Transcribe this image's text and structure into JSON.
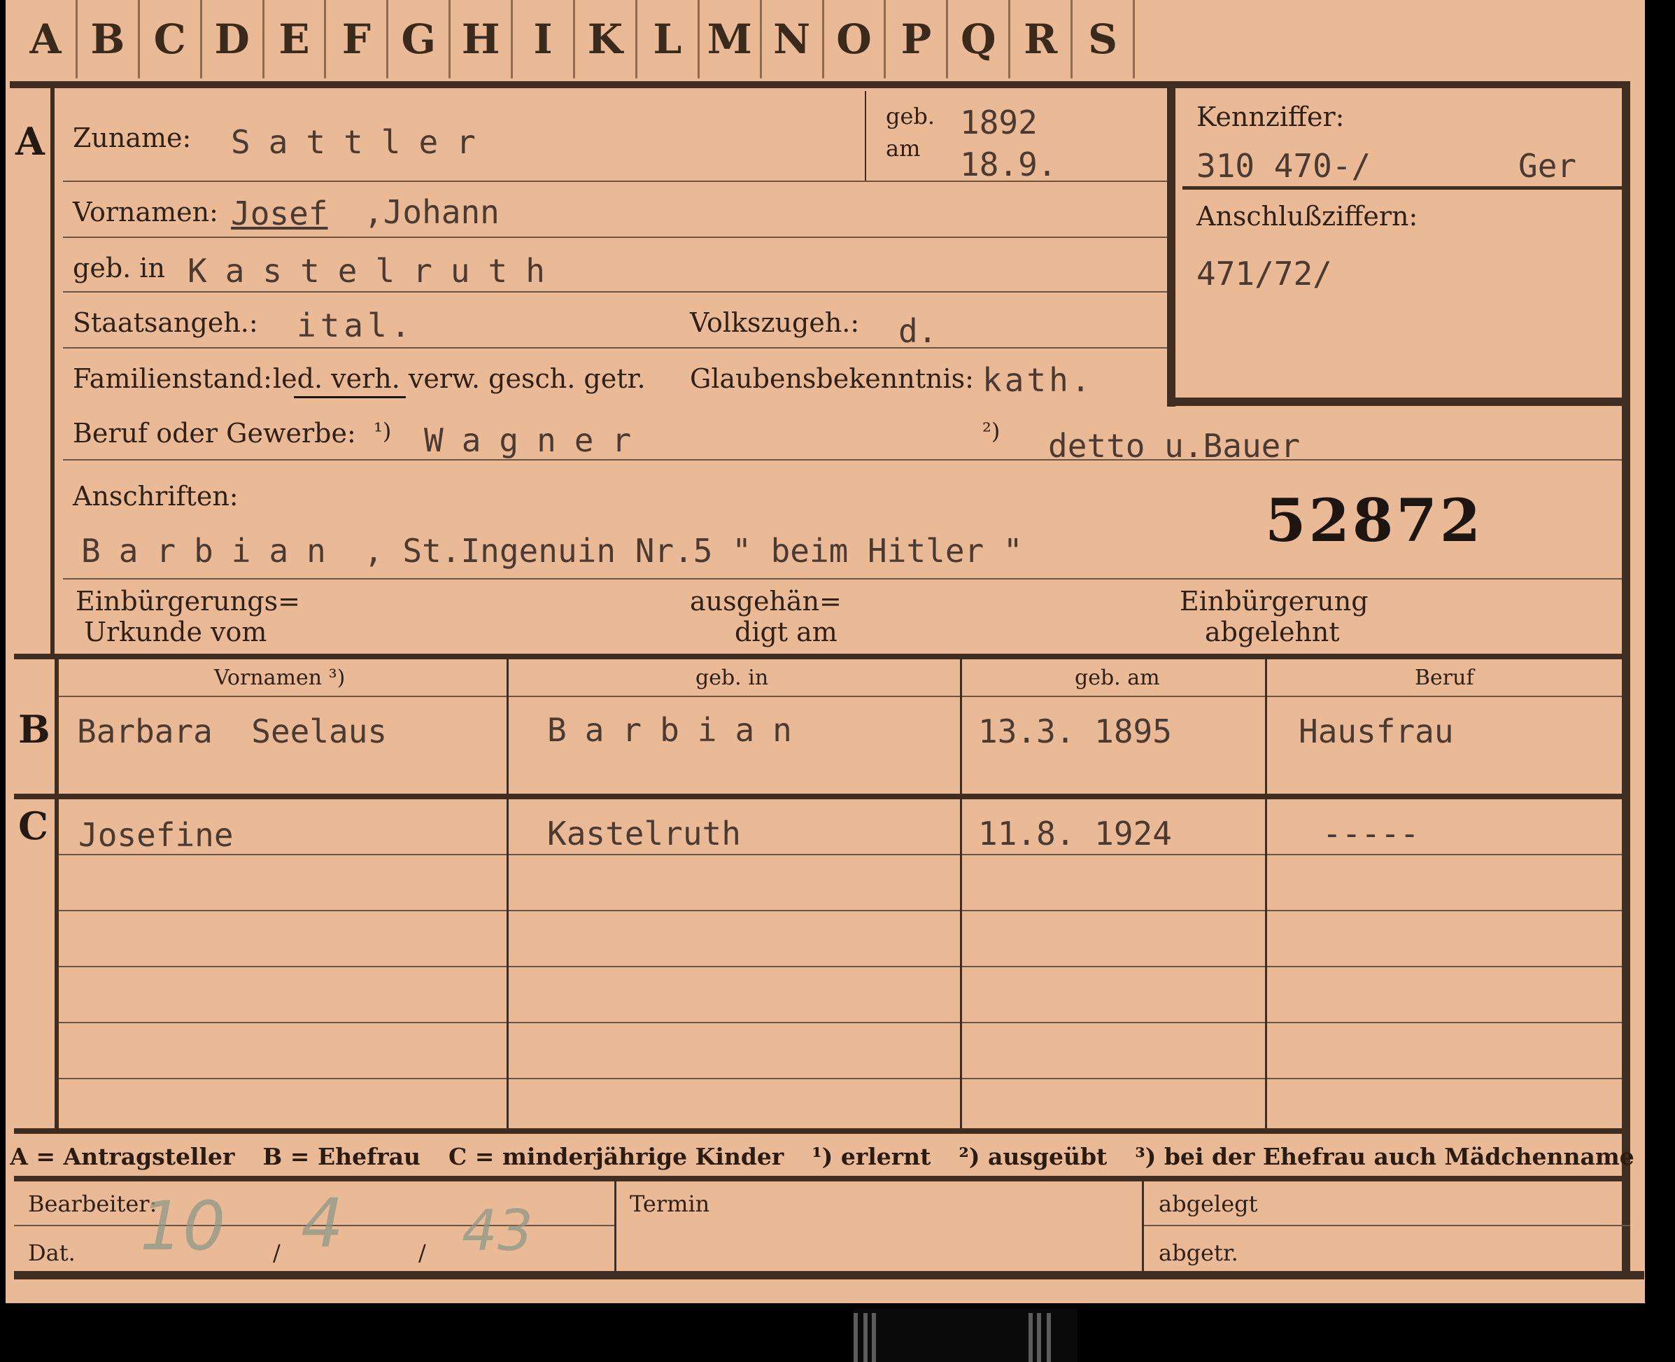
{
  "tabs": [
    "A",
    "B",
    "C",
    "D",
    "E",
    "F",
    "G",
    "H",
    "I",
    "K",
    "L",
    "M",
    "N",
    "O",
    "P",
    "Q",
    "R",
    "S"
  ],
  "sections": {
    "a": "A",
    "b": "B",
    "c": "C"
  },
  "labels": {
    "zuname": "Zuname:",
    "geb": "geb.",
    "am": "am",
    "kennziffer": "Kennziffer:",
    "anschlussziffern": "Anschlußziffern:",
    "vornamen": "Vornamen:",
    "geb_in": "geb. in",
    "staatsangeh": "Staatsangeh.:",
    "volkszugeh": "Volkszugeh.:",
    "familienstand": "Familienstand:",
    "fam_options": "led. verh. verw. gesch. getr.",
    "glaubensbekenntnis": "Glaubensbekenntnis:",
    "beruf_oder_gewerbe": "Beruf oder Gewerbe:",
    "note1": "¹)",
    "note2": "²)",
    "anschriften": "Anschriften:",
    "einbuergerung_urkunde_1": "Einbürgerungs=",
    "einbuergerung_urkunde_2": "Urkunde vom",
    "ausgehaendigt_1": "ausgehän=",
    "ausgehaendigt_2": "digt am",
    "einbuergerung_abgelehnt_1": "Einbürgerung",
    "einbuergerung_abgelehnt_2": "abgelehnt",
    "col_vornamen": "Vornamen ³)",
    "col_geb_in": "geb. in",
    "col_geb_am": "geb. am",
    "col_beruf": "Beruf",
    "bearbeiter": "Bearbeiter:",
    "dat": "Dat.",
    "termin": "Termin",
    "abgelegt": "abgelegt",
    "abgetr": "abgetr."
  },
  "values": {
    "zuname": "Sattler",
    "geb_year": "1892",
    "geb_date": "18.9.",
    "kennziffer": "310 470-/",
    "kennziffer_suffix": "Ger",
    "anschlussziffern": "471/72/",
    "vornamen_1": "Josef",
    "vornamen_2": ",Johann",
    "geb_in": "Kastelruth",
    "staatsangeh": "ital.",
    "volkszugeh": "d.",
    "glaubensbekenntnis": "kath.",
    "beruf_1": "Wagner",
    "beruf_2": "detto u.Bauer",
    "anschrift_ort": "Barbian",
    "anschrift_rest": ", St.Ingenuin Nr.5 \" beim Hitler \"",
    "file_number": "52872"
  },
  "spouse": {
    "vornamen": "Barbara  Seelaus",
    "geb_in": "Barbian",
    "geb_am": "13.3. 1895",
    "beruf": "Hausfrau"
  },
  "children": [
    {
      "vornamen": "Josefine",
      "geb_in": "Kastelruth",
      "geb_am": "11.8. 1924",
      "beruf": "-----"
    }
  ],
  "legend": [
    "A = Antragsteller",
    "B = Ehefrau",
    "C = minderjährige Kinder",
    "¹) erlernt",
    "²) ausgeübt",
    "³) bei der Ehefrau auch Mädchenname"
  ],
  "handwritten_date": {
    "day": "10",
    "month": "4",
    "year": "43"
  },
  "colors": {
    "card": "#eab995",
    "ink": "#2a1c12",
    "typewriter": "#4a3a32",
    "pencil": "#8c9a88"
  }
}
